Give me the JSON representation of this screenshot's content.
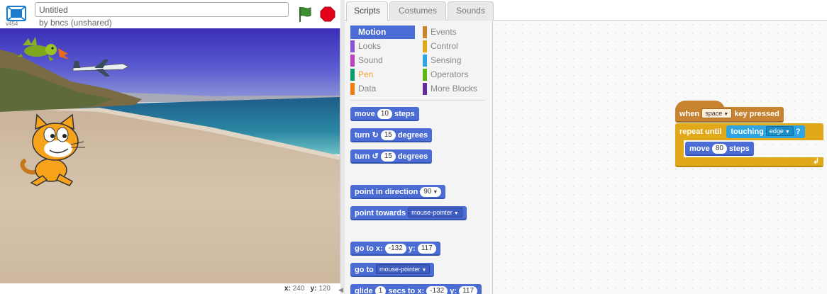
{
  "stage": {
    "title_value": "Untitled",
    "byline": "by bncs (unshared)",
    "version": "v454",
    "coords": {
      "x_label": "x:",
      "x_value": "240",
      "y_label": "y:",
      "y_value": "120"
    }
  },
  "tabs": [
    {
      "label": "Scripts",
      "active": true
    },
    {
      "label": "Costumes",
      "active": false
    },
    {
      "label": "Sounds",
      "active": false
    }
  ],
  "categories": [
    {
      "label": "Motion",
      "color": "#4a6cd4",
      "selected": true
    },
    {
      "label": "Events",
      "color": "#c88330",
      "selected": false
    },
    {
      "label": "Looks",
      "color": "#8a55d7",
      "selected": false
    },
    {
      "label": "Control",
      "color": "#e1a91a",
      "selected": false
    },
    {
      "label": "Sound",
      "color": "#bb42c3",
      "selected": false
    },
    {
      "label": "Sensing",
      "color": "#2ca5e2",
      "selected": false
    },
    {
      "label": "Pen",
      "color": "#0e9a6c",
      "selected": false
    },
    {
      "label": "Operators",
      "color": "#5cb712",
      "selected": false
    },
    {
      "label": "Data",
      "color": "#ee7d16",
      "selected": false
    },
    {
      "label": "More Blocks",
      "color": "#632d99",
      "selected": false
    }
  ],
  "palette": {
    "move": {
      "a": "move",
      "n": "10",
      "b": "steps"
    },
    "turn_right": {
      "a": "turn",
      "n": "15",
      "b": "degrees"
    },
    "turn_left": {
      "a": "turn",
      "n": "15",
      "b": "degrees"
    },
    "point_dir": {
      "a": "point in direction",
      "n": "90"
    },
    "point_towards": {
      "a": "point towards",
      "d": "mouse-pointer"
    },
    "goto_xy": {
      "a": "go to x:",
      "x": "-132",
      "b": "y:",
      "y": "117"
    },
    "goto": {
      "a": "go to",
      "d": "mouse-pointer"
    },
    "glide": {
      "a": "glide",
      "n": "1",
      "b": "secs to x:",
      "x": "-132",
      "c": "y:",
      "y": "117"
    }
  },
  "script": {
    "hat": {
      "a": "when",
      "d": "space",
      "b": "key pressed"
    },
    "repeat": {
      "a": "repeat until",
      "s": "touching",
      "d": "edge",
      "q": "?"
    },
    "inner_move": {
      "a": "move",
      "n": "80",
      "b": "steps"
    }
  },
  "colors": {
    "motion": "#4a6cd4",
    "events": "#c88330",
    "control": "#e1a91a",
    "sensing": "#2ca5e2",
    "flag": "#3f8e32",
    "stop": "#e3001a"
  },
  "icons": {
    "fullscreen": "fullscreen-icon",
    "flag": "green-flag-icon",
    "stop": "stop-sign-icon",
    "turn_right": "rotate-clockwise-icon",
    "turn_left": "rotate-counterclockwise-icon",
    "collapse": "collapse-arrow-icon"
  }
}
